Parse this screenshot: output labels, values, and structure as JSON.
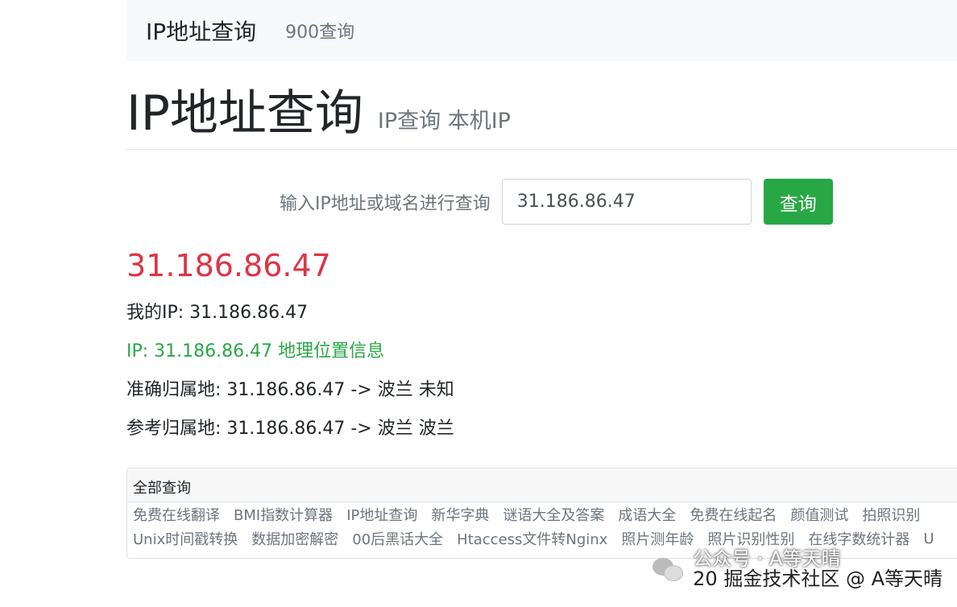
{
  "navbar": {
    "brand": "IP地址查询",
    "link": "900查询"
  },
  "header": {
    "title": "IP地址查询",
    "subtitle": "IP查询 本机IP"
  },
  "form": {
    "label": "输入IP地址或域名进行查询",
    "input_value": "31.186.86.47",
    "button": "查询"
  },
  "result": {
    "ip": "31.186.86.47",
    "my_ip": "我的IP: 31.186.86.47",
    "geo_link": "IP: 31.186.86.47 地理位置信息",
    "accurate": "准确归属地: 31.186.86.47 -> 波兰 未知",
    "reference": "参考归属地: 31.186.86.47 -> 波兰 波兰"
  },
  "all_queries": {
    "title": "全部查询",
    "row1": [
      "免费在线翻译",
      "BMI指数计算器",
      "IP地址查询",
      "新华字典",
      "谜语大全及答案",
      "成语大全",
      "免费在线起名",
      "颜值测试",
      "拍照识别"
    ],
    "row2": [
      "Unix时间戳转换",
      "数据加密解密",
      "00后黑话大全",
      "Htaccess文件转Nginx",
      "照片测年龄",
      "照片识别性别",
      "在线字数统计器",
      "U"
    ]
  },
  "watermark": {
    "line1": "公众号 · A等天晴",
    "line2": "20 掘金技术社区 @ A等天晴"
  }
}
